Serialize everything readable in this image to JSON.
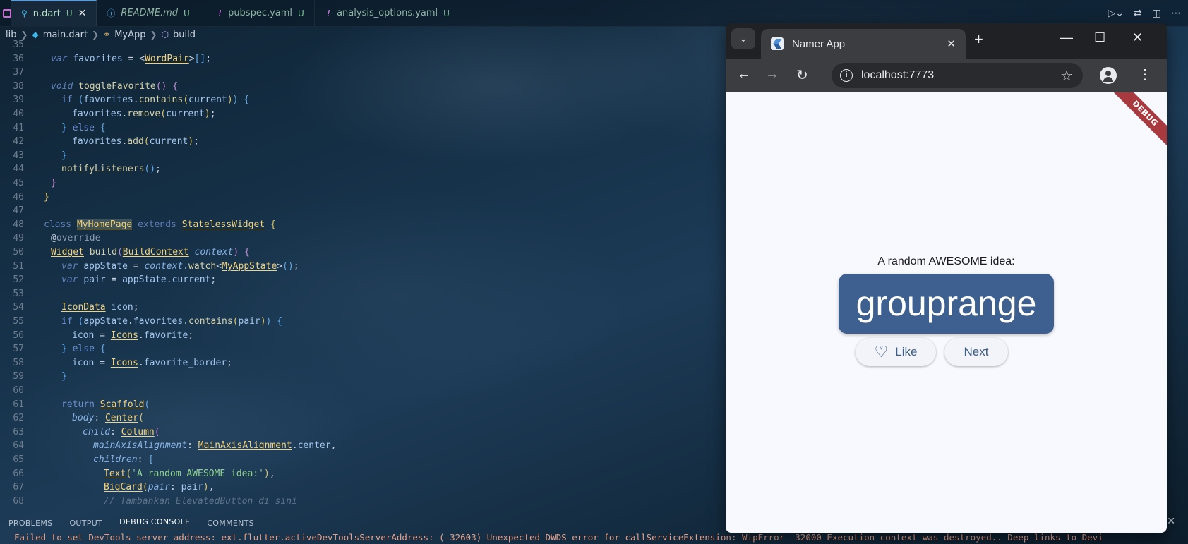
{
  "editor": {
    "tabs": [
      {
        "name": "n.dart",
        "status": "U",
        "active": true,
        "icon": "dart-search-icon"
      },
      {
        "name": "README.md",
        "status": "U",
        "icon": "info-icon"
      },
      {
        "name": "pubspec.yaml",
        "status": "U",
        "icon": "yaml-icon"
      },
      {
        "name": "analysis_options.yaml",
        "status": "U",
        "icon": "yaml-icon"
      }
    ],
    "close_glyph": "✕",
    "breadcrumb": [
      "lib",
      "main.dart",
      "MyApp",
      "build"
    ],
    "line_numbers": [
      "35",
      "36",
      "37",
      "38",
      "39",
      "40",
      "41",
      "42",
      "43",
      "44",
      "45",
      "46",
      "47",
      "48",
      "49",
      "50",
      "51",
      "52",
      "53",
      "54",
      "55",
      "56",
      "57",
      "58",
      "59",
      "60",
      "61",
      "62",
      "63",
      "64",
      "65",
      "66",
      "67",
      "68"
    ],
    "code_strings": {
      "l66_str": "'A random AWESOME idea:'",
      "l68_comment": "// Tambahkan ElevatedButton di sini"
    },
    "panel_tabs": [
      "PROBLEMS",
      "OUTPUT",
      "DEBUG CONSOLE",
      "COMMENTS"
    ],
    "active_panel_tab": "DEBUG CONSOLE",
    "console_line": "Failed to set DevTools server address: ext.flutter.activeDevToolsServerAddress: (-32603) Unexpected DWDS error for callServiceExtension: WipError -32000 Execution context was destroyed.. Deep links to Devi"
  },
  "browser": {
    "tab_title": "Namer App",
    "url": "localhost:7773",
    "debug_banner": "DEBUG",
    "app": {
      "prompt": "A random AWESOME idea:",
      "word_pair": "grouprange",
      "like_label": "Like",
      "next_label": "Next"
    }
  },
  "colors": {
    "card": "#3d6090",
    "button_text": "#3d5e8a",
    "page_bg": "#f7f9fe",
    "debug_banner": "#a83a3f"
  }
}
